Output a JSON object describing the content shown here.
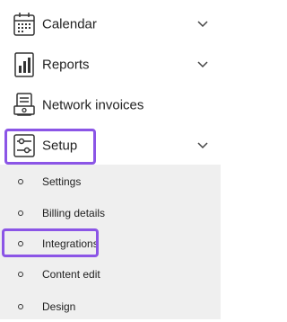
{
  "nav": {
    "main_items": [
      {
        "label": "Calendar",
        "icon": "calendar-icon",
        "expanded": false
      },
      {
        "label": "Reports",
        "icon": "reports-icon",
        "expanded": false
      },
      {
        "label": "Network invoices",
        "icon": "invoice-icon"
      },
      {
        "label": "Setup",
        "icon": "sliders-icon",
        "expanded": true
      }
    ],
    "setup_subitems": [
      {
        "label": "Settings"
      },
      {
        "label": "Billing details"
      },
      {
        "label": "Integrations"
      },
      {
        "label": "Content edit"
      },
      {
        "label": "Design"
      }
    ]
  },
  "colors": {
    "highlight": "#8b55e6",
    "submenu_background": "#efefef",
    "text": "#222222"
  }
}
